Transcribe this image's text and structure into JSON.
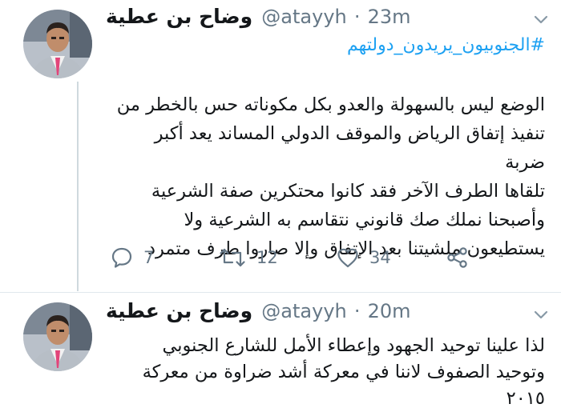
{
  "tweets": [
    {
      "author": {
        "name": "وضاح بن عطية",
        "handle": "@atayyh",
        "separator": "·",
        "time": "23m"
      },
      "hashtag": "#الجنوبيون_يريدون_دولتهم",
      "lines": [
        "الوضع ليس بالسهولة والعدو بكل مكوناته حس بالخطر من",
        "تنفيذ إتفاق الرياض والموقف الدولي المساند يعد أكبر ضربة",
        "تلقاها الطرف الآخر فقد كانوا محتكرين صفة الشرعية",
        "وأصبحنا نملك صك قانوني نتقاسم به الشرعية ولا",
        "يستطيعون ملشيتنا بعد الإتفاق وإلا صاروا طرف متمرد"
      ],
      "actions": {
        "reply_count": "7",
        "retweet_count": "12",
        "like_count": "34"
      }
    },
    {
      "author": {
        "name": "وضاح بن عطية",
        "handle": "@atayyh",
        "separator": "·",
        "time": "20m"
      },
      "lines": [
        "لذا علينا توحيد الجهود وإعطاء الأمل للشارع الجنوبي",
        "وتوحيد الصفوف لاننا في معركة أشد ضراوة من معركة",
        "٢٠١٥"
      ]
    }
  ],
  "icons": {
    "reply": "comment-bubble-icon",
    "retweet": "retweet-icon",
    "like": "heart-icon",
    "share": "share-icon",
    "caret": "chevron-down-icon"
  },
  "colors": {
    "link": "#1da1f2",
    "secondary_text": "#657786",
    "primary_text": "#14171a",
    "divider": "#e1e8ed"
  }
}
